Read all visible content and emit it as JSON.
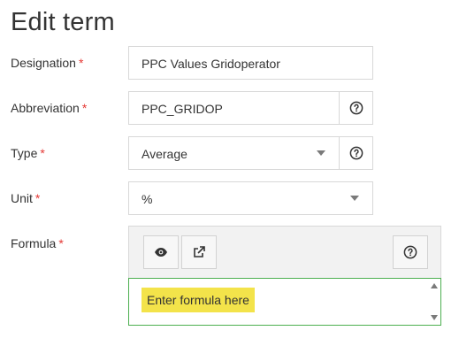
{
  "page": {
    "title": "Edit term"
  },
  "fields": {
    "designation": {
      "label": "Designation",
      "value": "PPC Values Gridoperator"
    },
    "abbreviation": {
      "label": "Abbreviation",
      "value": "PPC_GRIDOP"
    },
    "type": {
      "label": "Type",
      "value": "Average"
    },
    "unit": {
      "label": "Unit",
      "value": "%"
    },
    "formula": {
      "label": "Formula",
      "placeholder": "Enter formula here"
    }
  },
  "required_marker": "*",
  "icons": {
    "help": "question-circle-icon",
    "preview": "eye-icon",
    "open_external": "external-link-icon",
    "dropdown": "chevron-down-icon"
  },
  "colors": {
    "required": "#e53935",
    "editor_border": "#4caf50",
    "placeholder_highlight": "#f3e34a"
  }
}
